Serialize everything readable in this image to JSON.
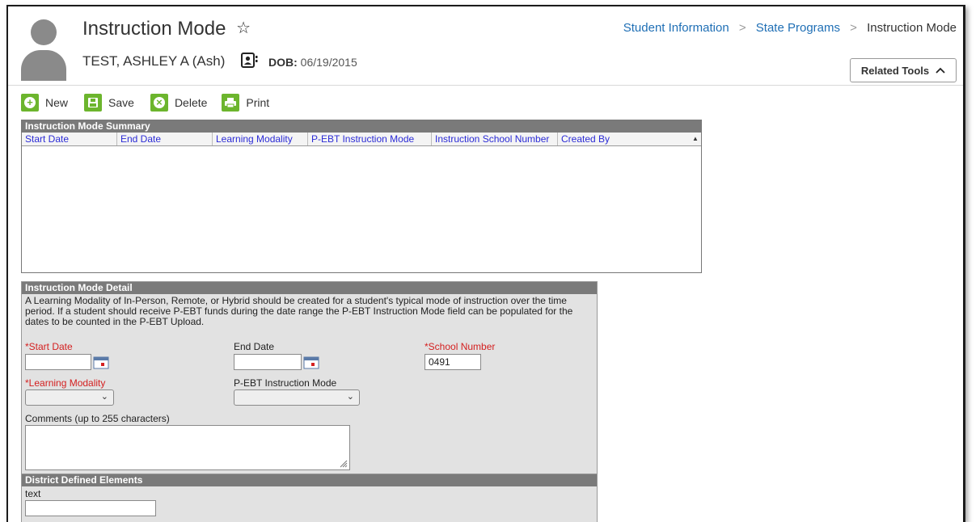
{
  "header": {
    "title": "Instruction Mode",
    "student_name": "TEST, ASHLEY A (Ash)",
    "dob_label": "DOB:",
    "dob_value": "06/19/2015",
    "icons": [
      "star-icon",
      "contact-card-icon",
      "avatar"
    ]
  },
  "breadcrumb": {
    "items": [
      "Student Information",
      "State Programs",
      "Instruction Mode"
    ],
    "link_color": "#1f6fb5"
  },
  "related_tools": {
    "label": "Related Tools"
  },
  "toolbar": {
    "new_label": "New",
    "save_label": "Save",
    "delete_label": "Delete",
    "print_label": "Print",
    "accent": "#6cb52d"
  },
  "summary": {
    "title": "Instruction Mode Summary",
    "columns": [
      "Start Date",
      "End Date",
      "Learning Modality",
      "P-EBT Instruction Mode",
      "Instruction School Number",
      "Created By"
    ],
    "rows": []
  },
  "detail": {
    "title": "Instruction Mode Detail",
    "description": "A Learning Modality of In-Person, Remote, or Hybrid should be created for a student's typical mode of instruction over the time period. If a student should receive P-EBT funds during the date range the P-EBT Instruction Mode field can be populated for the dates to be counted in the P-EBT Upload.",
    "start_date_label": "*Start Date",
    "start_date_value": "",
    "end_date_label": "End Date",
    "end_date_value": "",
    "school_number_label": "*School Number",
    "school_number_value": "0491",
    "learning_modality_label": "*Learning Modality",
    "learning_modality_value": "",
    "pebt_label": "P-EBT Instruction Mode",
    "pebt_value": "",
    "comments_label": "Comments (up to 255 characters)",
    "comments_value": "",
    "required_color": "#d42020"
  },
  "district": {
    "title": "District Defined Elements",
    "text_label": "text",
    "text_value": ""
  }
}
